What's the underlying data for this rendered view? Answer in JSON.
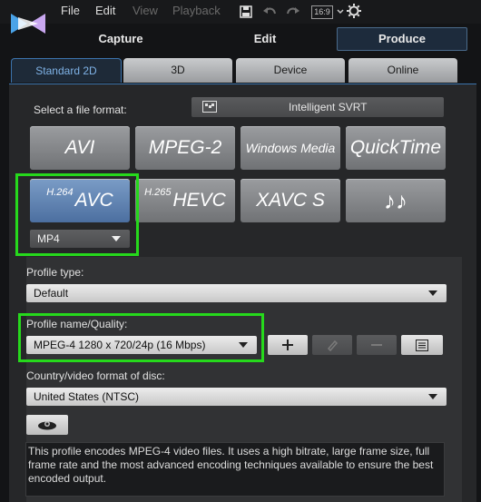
{
  "menu": {
    "file": "File",
    "edit": "Edit",
    "view": "View",
    "playback": "Playback",
    "aspect": "16:9"
  },
  "modes": {
    "capture": "Capture",
    "edit": "Edit",
    "produce": "Produce"
  },
  "format_tabs": [
    "Standard 2D",
    "3D",
    "Device",
    "Online"
  ],
  "file_format": {
    "label": "Select a file format:",
    "svrt_label": "Intelligent SVRT",
    "buttons": {
      "avi": "AVI",
      "mpeg2": "MPEG-2",
      "wmv": "Windows Media",
      "quicktime": "QuickTime",
      "avc_sup": "H.264",
      "avc": "AVC",
      "hevc_sup": "H.265",
      "hevc": "HEVC",
      "xavcs": "XAVC S",
      "audio": "♪♪"
    },
    "container": "MP4"
  },
  "profile": {
    "type_label": "Profile type:",
    "type_value": "Default",
    "name_label": "Profile name/Quality:",
    "name_value": "MPEG-4 1280 x 720/24p (16 Mbps)"
  },
  "country": {
    "label": "Country/video format of disc:",
    "value": "United States (NTSC)"
  },
  "description": "This profile encodes MPEG-4 video files. It uses a high bitrate, large frame size, full frame rate and the most advanced encoding techniques available to ensure the best encoded output.",
  "colors": {
    "highlight": "#26d91c",
    "accent": "#3c74ad",
    "selected_format": "#5a7fb0"
  }
}
